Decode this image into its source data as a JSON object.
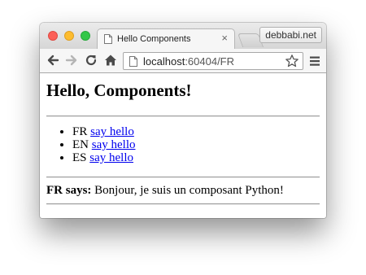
{
  "window": {
    "tab_title": "Hello Components",
    "tab_close": "×",
    "profile_name": "debbabi.net"
  },
  "toolbar": {
    "url_host": "localhost",
    "url_rest": ":60404/FR"
  },
  "page": {
    "heading": "Hello, Components!",
    "languages": [
      {
        "code": "FR",
        "link": "say hello"
      },
      {
        "code": "EN",
        "link": "say hello"
      },
      {
        "code": "ES",
        "link": "say hello"
      }
    ],
    "result_label": "FR says:",
    "result_text": " Bonjour, je suis un composant Python!"
  }
}
